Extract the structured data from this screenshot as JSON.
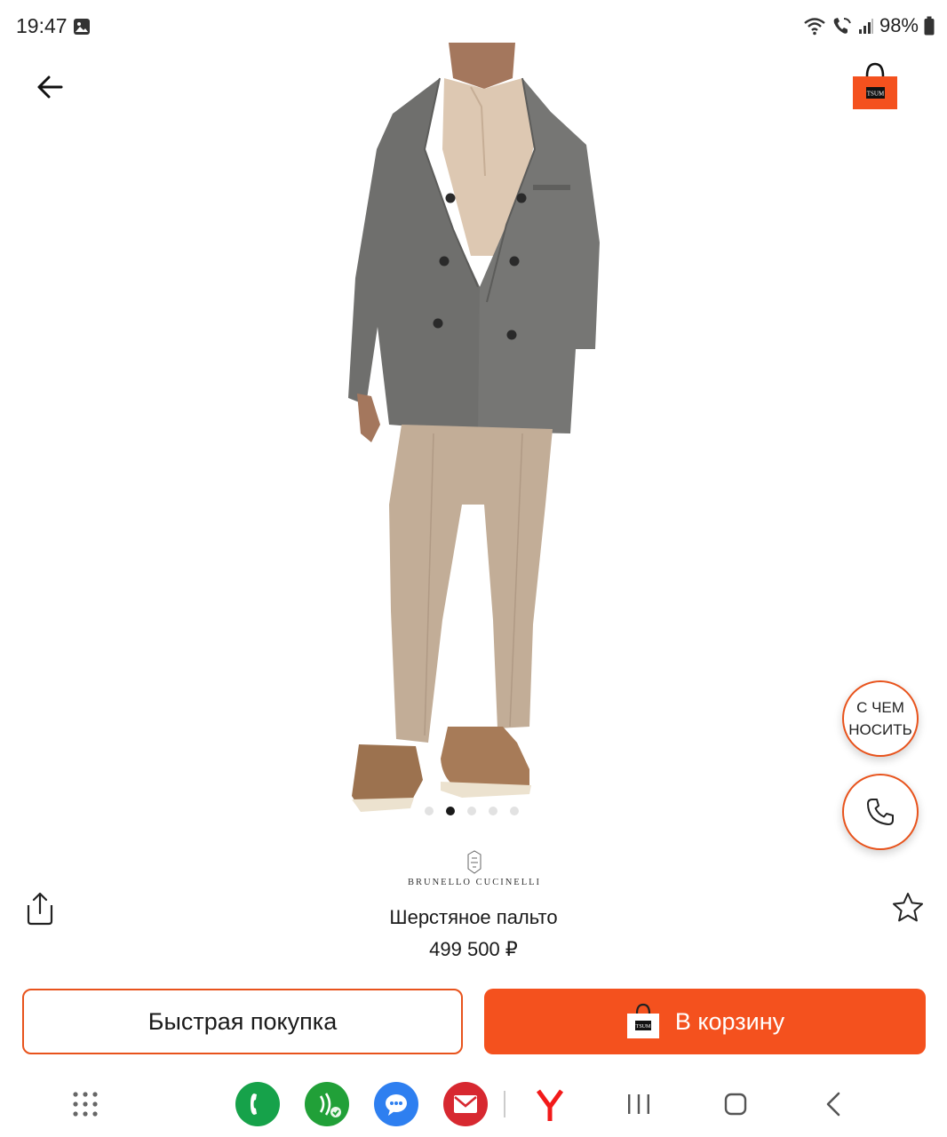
{
  "status_bar": {
    "time": "19:47",
    "battery": "98%",
    "icons": [
      "gallery-icon",
      "wifi-icon",
      "wifi-call-icon",
      "signal-icon",
      "battery-icon"
    ]
  },
  "header": {
    "back_icon": "arrow-left-icon",
    "cart_icon": "shopping-bag-icon",
    "cart_logo": "TSUM"
  },
  "product": {
    "brand": "BRUNELLO CUCINELLI",
    "title": "Шерстяное пальто",
    "price": "499 500 ₽",
    "image_count": 5,
    "active_image": 2
  },
  "floating": {
    "wear_with_line1": "С ЧЕМ",
    "wear_with_line2": "НОСИТЬ",
    "call_icon": "phone-icon"
  },
  "actions": {
    "quick_buy": "Быстрая покупка",
    "add_to_cart": "В корзину"
  },
  "colors": {
    "accent": "#f4511e",
    "accent_border": "#e8531c",
    "coat": "#6f6f6d",
    "trousers": "#c2ad97",
    "shoes": "#a77b58"
  },
  "dock": {
    "apps": [
      "apps-grid-icon",
      "phone-app-icon",
      "sber-pay-icon",
      "messages-icon",
      "mail-icon",
      "yandex-icon"
    ],
    "nav": [
      "recents-icon",
      "home-icon",
      "back-nav-icon"
    ]
  }
}
